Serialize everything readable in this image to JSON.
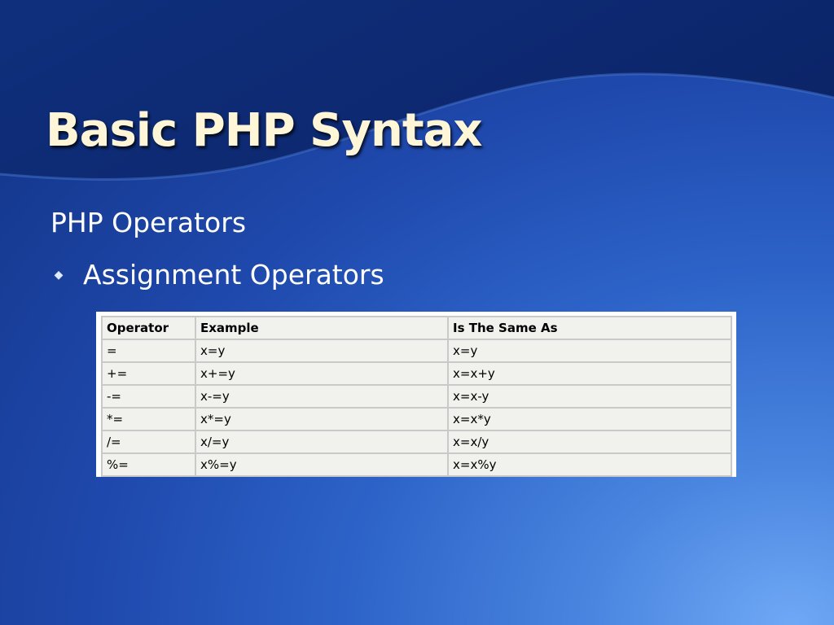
{
  "slide": {
    "title": "Basic PHP Syntax",
    "heading": "PHP Operators",
    "bullet": "Assignment Operators",
    "bullet_icon": "diamond-bullet-icon"
  },
  "table": {
    "headers": [
      "Operator",
      "Example",
      "Is The Same As"
    ],
    "rows": [
      [
        "=",
        "x=y",
        "x=y"
      ],
      [
        "+=",
        "x+=y",
        "x=x+y"
      ],
      [
        "-=",
        "x-=y",
        "x=x-y"
      ],
      [
        "*=",
        "x*=y",
        "x=x*y"
      ],
      [
        "/=",
        "x/=y",
        "x=x/y"
      ],
      [
        "%=",
        "x%=y",
        "x=x%y"
      ]
    ]
  }
}
